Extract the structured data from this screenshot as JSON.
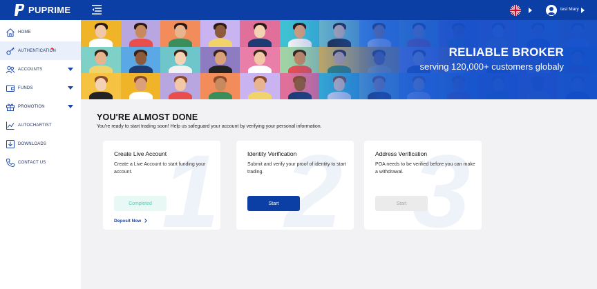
{
  "brand": {
    "name": "PUPRIME",
    "primary": "#0c3fa6",
    "sidebar_bg": "#ffffff",
    "page_bg": "#f2f2f4"
  },
  "header": {
    "user_name": "test Mary",
    "language_icon": "uk-flag-icon",
    "menu_icon": "menu-collapse-icon"
  },
  "sidebar": {
    "items": [
      {
        "label": "HOME",
        "icon": "home-icon",
        "expandable": false,
        "active": false
      },
      {
        "label": "AUTHENTICATION",
        "icon": "key-icon",
        "expandable": false,
        "active": true,
        "notification_dot": true
      },
      {
        "label": "ACCOUNTS",
        "icon": "accounts-icon",
        "expandable": true,
        "active": false
      },
      {
        "label": "FUNDS",
        "icon": "funds-icon",
        "expandable": true,
        "active": false
      },
      {
        "label": "PROMOTION",
        "icon": "gift-icon",
        "expandable": true,
        "active": false
      },
      {
        "label": "AUTOCHARTIST",
        "icon": "chart-icon",
        "expandable": false,
        "active": false
      },
      {
        "label": "DOWNLOADS",
        "icon": "download-icon",
        "expandable": false,
        "active": false
      },
      {
        "label": "CONTACT US",
        "icon": "phone-icon",
        "expandable": false,
        "active": false
      }
    ]
  },
  "banner": {
    "title": "RELIABLE BROKER",
    "subtitle": "serving 120,000+ customers globaly"
  },
  "main": {
    "heading": "YOU'RE ALMOST DONE",
    "subheading": "You're ready to start trading soon! Help us safeguard your account by verifying your personal information.",
    "cards": [
      {
        "number": "1",
        "title": "Create Live Account",
        "description": "Create a Live Account to start funding your account.",
        "button": "Completed",
        "button_state": "completed",
        "link": "Deposit Now"
      },
      {
        "number": "2",
        "title": "Identity Verification",
        "description": "Submit and verify your proof of identity to start trading.",
        "button": "Start",
        "button_state": "active"
      },
      {
        "number": "3",
        "title": "Address Verification",
        "description": "POA needs to be verified before you can make a withdrawal.",
        "button": "Start",
        "button_state": "disabled"
      }
    ]
  }
}
